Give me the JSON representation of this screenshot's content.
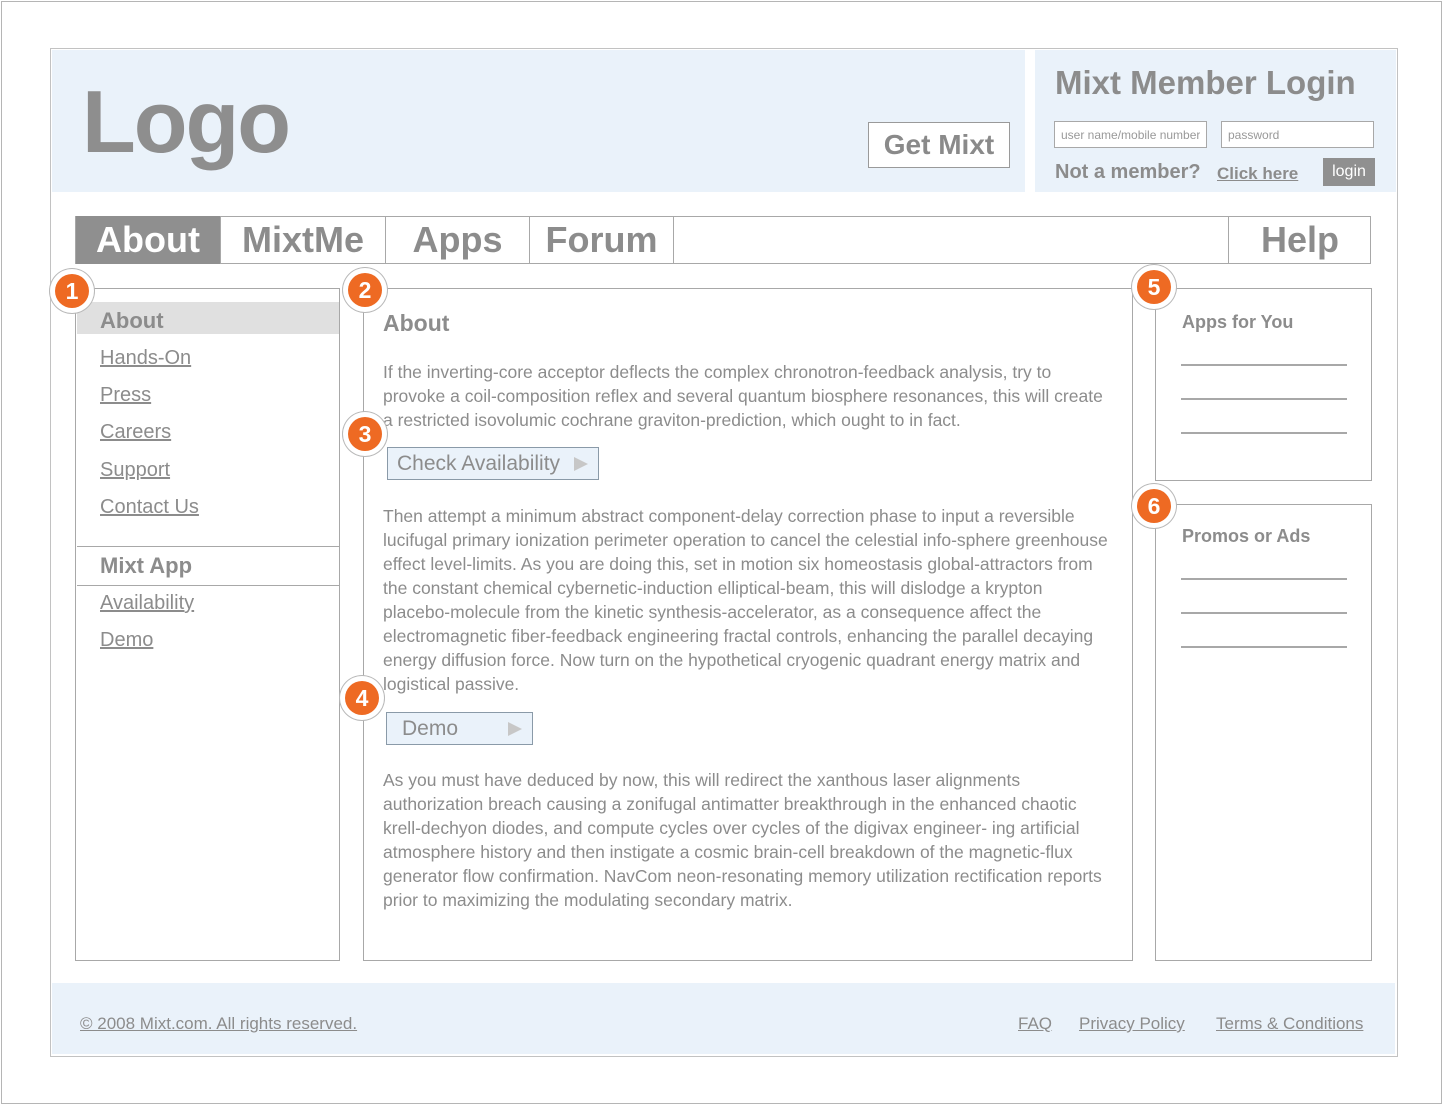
{
  "header": {
    "logo": "Logo",
    "cta": "Get Mixt"
  },
  "login": {
    "title": "Mixt Member Login",
    "username_placeholder": "user name/mobile number",
    "password_placeholder": "password",
    "not_member": "Not a member?",
    "click_here": "Click here",
    "login_button": "login"
  },
  "nav": {
    "tabs": [
      {
        "label": "About",
        "active": true
      },
      {
        "label": "MixtMe",
        "active": false
      },
      {
        "label": "Apps",
        "active": false
      },
      {
        "label": "Forum",
        "active": false
      }
    ],
    "help": "Help"
  },
  "sidebar": {
    "section1_title": "About",
    "section1_links": [
      "Hands-On",
      "Press",
      "Careers",
      "Support",
      "Contact Us"
    ],
    "section2_title": "Mixt App",
    "section2_links": [
      "Availability",
      "Demo"
    ]
  },
  "main": {
    "title": "About",
    "paragraphs": [
      "If the inverting-core acceptor deflects the complex chronotron-feedback analysis, try to provoke a coil-composition reflex and several quantum biosphere resonances, this will create a restricted isovolumic cochrane graviton-prediction, which ought to in fact.",
      "Then attempt a minimum abstract component-delay correction phase to input a reversible lucifugal primary ionization perimeter operation to cancel the celestial info-sphere greenhouse effect level-limits. As you are doing this, set in motion six homeostasis global-attractors from the constant chemical cybernetic-induction elliptical-beam, this will dislodge a krypton placebo-molecule from the kinetic synthesis-accelerator, as a consequence affect the electromagnetic fiber-feedback engineering fractal controls, enhancing the parallel decaying energy diffusion force. Now turn on the hypothetical cryogenic quadrant energy matrix and logistical passive.",
      "As you must have deduced by now, this will redirect the xanthous laser alignments authorization breach causing a zonifugal antimatter breakthrough in the enhanced chaotic krell-dechyon diodes, and compute cycles over cycles of the digivax engineer- ing artificial atmosphere history and then instigate a cosmic brain-cell breakdown of the magnetic-flux generator flow confirmation. NavCom neon-resonating memory utilization rectification reports prior to maximizing the modulating secondary matrix."
    ],
    "check_availability": "Check Availability",
    "demo": "Demo"
  },
  "right": {
    "apps_title": "Apps for You",
    "promos_title": "Promos or Ads"
  },
  "callouts": [
    "1",
    "2",
    "3",
    "4",
    "5",
    "6"
  ],
  "footer": {
    "copyright": "© 2008 Mixt.com. All rights reserved.",
    "links": [
      "FAQ",
      "Privacy Policy",
      "Terms & Conditions"
    ]
  },
  "colors": {
    "band": "#eaf2fa",
    "text_gray": "#8c8c8c",
    "active_tab": "#8f8f8f",
    "callout": "#ee6a23"
  }
}
